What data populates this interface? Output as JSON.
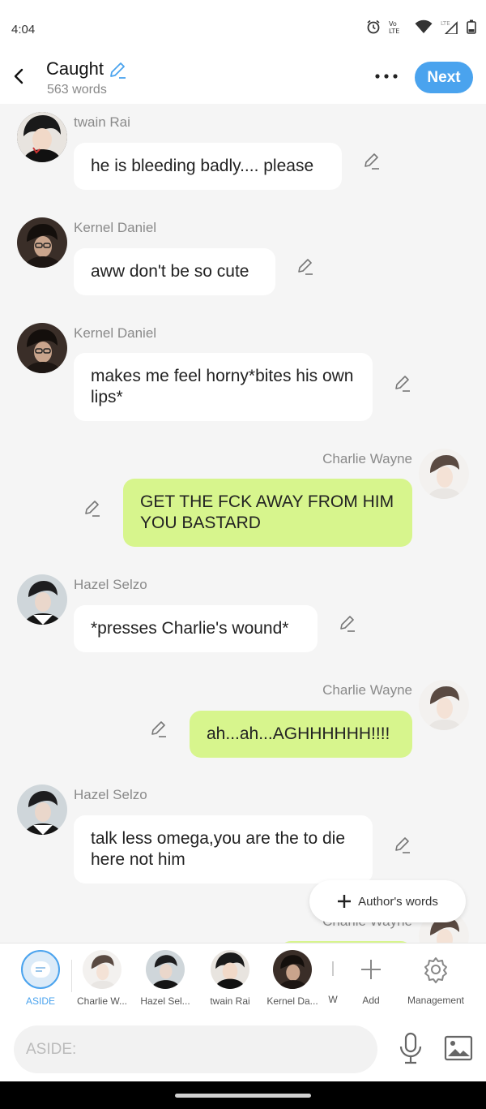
{
  "status": {
    "time": "4:04"
  },
  "header": {
    "title": "Caught",
    "word_count": "563 words",
    "next_label": "Next"
  },
  "messages": [
    {
      "name": "twain Rai",
      "text": "he is bleeding badly.... please",
      "side": "left"
    },
    {
      "name": "Kernel Daniel",
      "text": "aww don't be so cute",
      "side": "left"
    },
    {
      "name": "Kernel Daniel",
      "text": "makes me feel horny*bites his own lips*",
      "side": "left"
    },
    {
      "name": "Charlie Wayne",
      "text": "GET THE FCK AWAY FROM HIM YOU BASTARD",
      "side": "right"
    },
    {
      "name": "Hazel Selzo",
      "text": "*presses Charlie's wound*",
      "side": "left"
    },
    {
      "name": "Charlie Wayne",
      "text": "ah...ah...AGHHHHHH!!!!",
      "side": "right"
    },
    {
      "name": "Hazel Selzo",
      "text": "talk less omega,you are the to die here not him",
      "side": "left"
    },
    {
      "name": "Charlie Wayne",
      "text": "",
      "side": "right"
    }
  ],
  "author_words_label": "Author's words",
  "characters": {
    "aside": "ASIDE",
    "items": [
      "Charlie W...",
      "Hazel Sel...",
      "twain Rai",
      "Kernel Da...",
      "W"
    ],
    "add": "Add",
    "management": "Management"
  },
  "input": {
    "placeholder": "ASIDE:"
  },
  "colors": {
    "accent": "#4aa3ee",
    "green_bubble": "#d7f58d"
  }
}
